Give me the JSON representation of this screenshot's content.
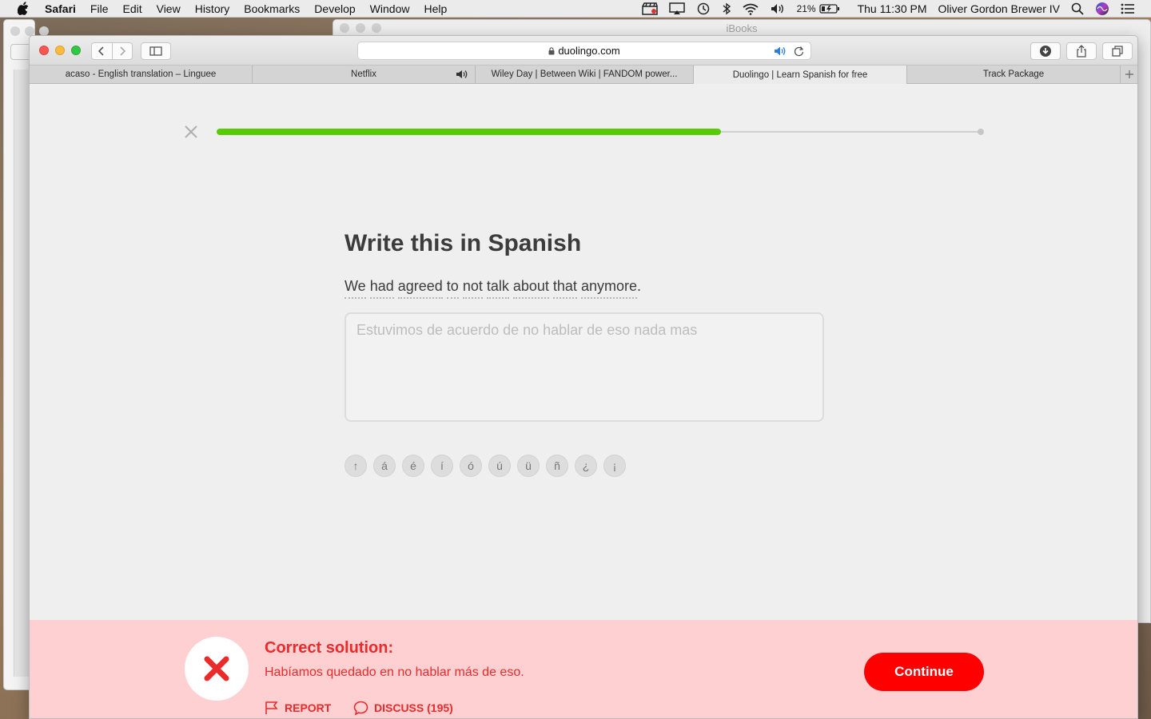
{
  "menubar": {
    "app": "Safari",
    "items": [
      "File",
      "Edit",
      "View",
      "History",
      "Bookmarks",
      "Develop",
      "Window",
      "Help"
    ],
    "battery": "21%",
    "clock": "Thu 11:30 PM",
    "user": "Oliver Gordon Brewer IV"
  },
  "background_window": {
    "title": "iBooks"
  },
  "browser": {
    "url": "duolingo.com",
    "tabs": [
      {
        "label": "acaso - English translation – Linguee",
        "active": false
      },
      {
        "label": "Netflix",
        "active": false,
        "audio": true
      },
      {
        "label": "Wiley Day | Between Wiki | FANDOM power...",
        "active": false
      },
      {
        "label": "Duolingo | Learn Spanish for free",
        "active": true
      },
      {
        "label": "Track Package",
        "active": false
      }
    ]
  },
  "lesson": {
    "progress": 0.66,
    "heading": "Write this in Spanish",
    "prompt_words": [
      "We",
      "had",
      "agreed",
      "to",
      "not",
      "talk",
      "about",
      "that",
      "anymore"
    ],
    "prompt_punct": ".",
    "answer_text": "Estuvimos de acuerdo de no hablar de eso nada mas",
    "special_chars": [
      "↑",
      "á",
      "é",
      "í",
      "ó",
      "ú",
      "ü",
      "ñ",
      "¿",
      "¡"
    ]
  },
  "feedback": {
    "status": "incorrect",
    "title": "Correct solution:",
    "solution": "Habíamos quedado en no hablar más de eso.",
    "report_label": "REPORT",
    "discuss_label": "DISCUSS (195)",
    "continue_label": "Continue"
  },
  "colors": {
    "progress_green": "#58cc02",
    "error_red": "#ea2b2b",
    "error_bg": "#ffd0d1",
    "continue_red": "#ff0000"
  }
}
